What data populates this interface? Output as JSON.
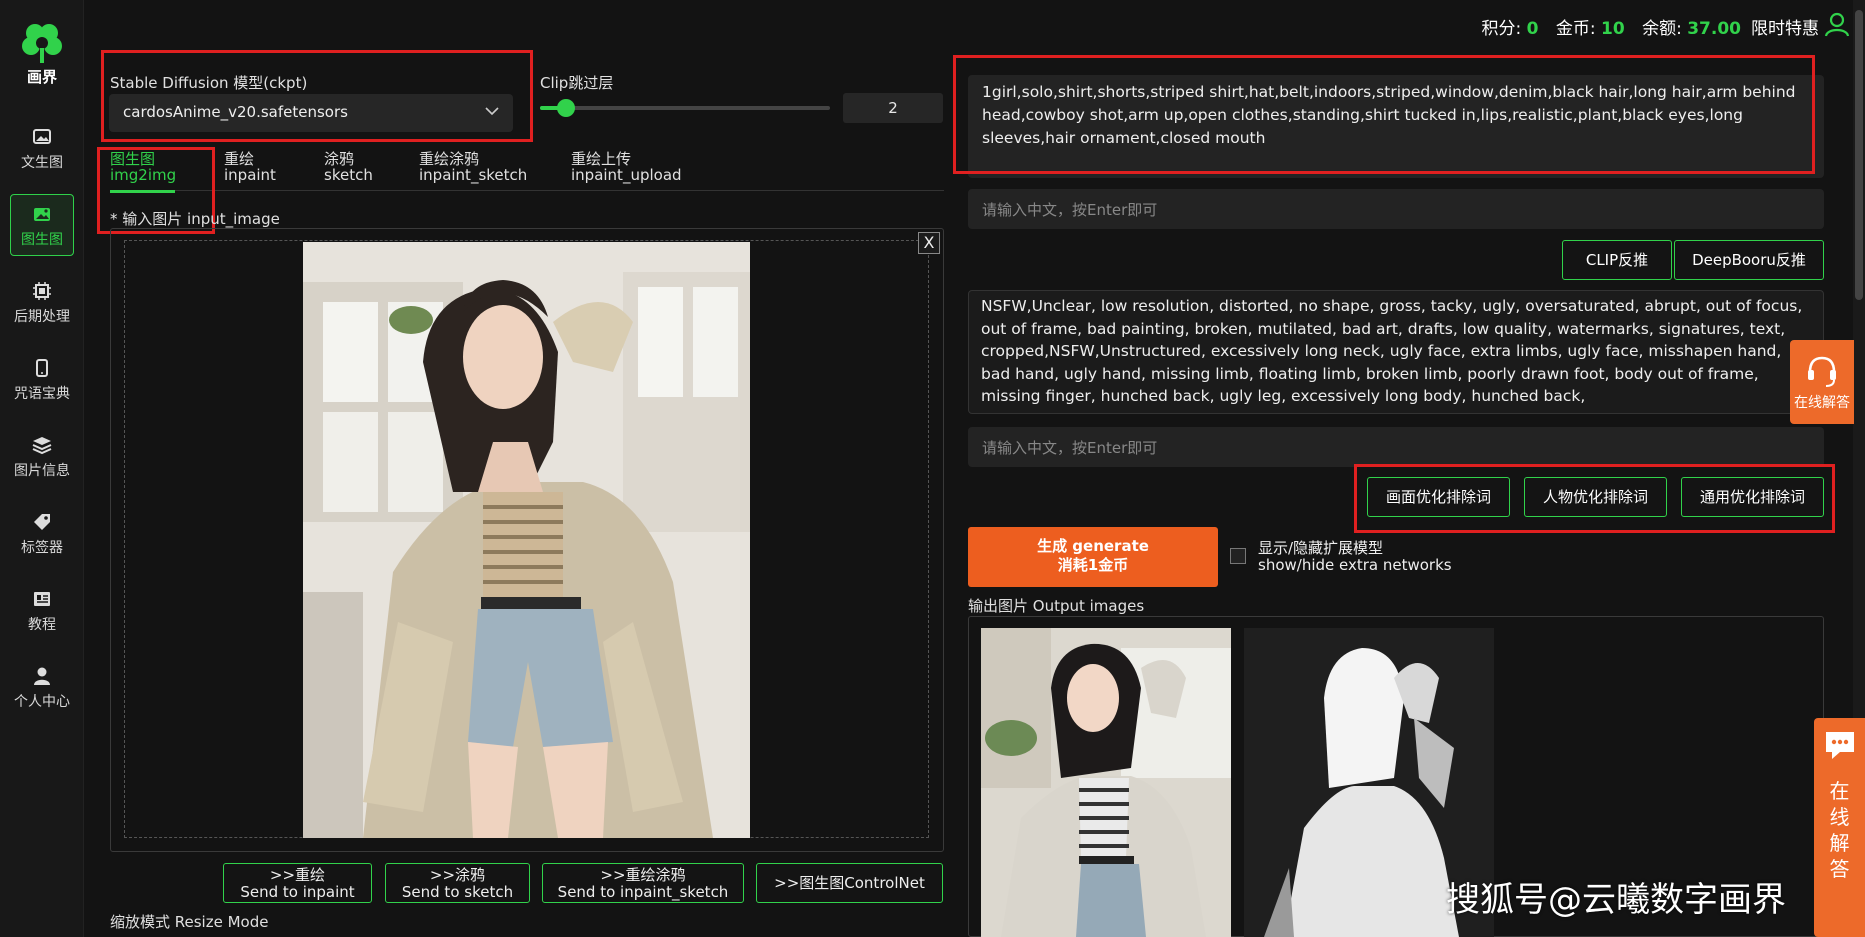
{
  "brand": {
    "name": "画界"
  },
  "sidebar": {
    "items": [
      {
        "label": "文生图",
        "icon": "image-icon"
      },
      {
        "label": "图生图",
        "icon": "image-to-image-icon",
        "active": true
      },
      {
        "label": "后期处理",
        "icon": "chip-icon"
      },
      {
        "label": "咒语宝典",
        "icon": "phone-book-icon"
      },
      {
        "label": "图片信息",
        "icon": "layers-icon"
      },
      {
        "label": "标签器",
        "icon": "tag-icon"
      },
      {
        "label": "教程",
        "icon": "book-icon"
      },
      {
        "label": "个人中心",
        "icon": "user-icon"
      }
    ]
  },
  "topbar": {
    "points_label": "积分:",
    "points_value": "0",
    "coins_label": "金币:",
    "coins_value": "10",
    "balance_label": "余额:",
    "balance_value": "37.00",
    "promo": "限时特惠"
  },
  "model": {
    "label": "Stable Diffusion 模型(ckpt)",
    "value": "cardosAnime_v20.safetensors"
  },
  "clip": {
    "label": "Clip跳过层",
    "value": "2",
    "slider_fraction": 0.09
  },
  "tabs": [
    {
      "line1": "图生图",
      "line2": "img2img",
      "active": true
    },
    {
      "line1": "重绘",
      "line2": "inpaint"
    },
    {
      "line1": "涂鸦",
      "line2": "sketch"
    },
    {
      "line1": "重绘涂鸦",
      "line2": "inpaint_sketch"
    },
    {
      "line1": "重绘上传",
      "line2": "inpaint_upload"
    }
  ],
  "input_image": {
    "label": "* 输入图片 input_image",
    "close": "X"
  },
  "send_buttons": [
    {
      "line1": ">>重绘",
      "line2": "Send to inpaint"
    },
    {
      "line1": ">>涂鸦",
      "line2": "Send to sketch"
    },
    {
      "line1": ">>重绘涂鸦",
      "line2": "Send to inpaint_sketch"
    },
    {
      "line1": ">>图生图ControlNet",
      "line2": ""
    }
  ],
  "resize_mode_label": "缩放模式 Resize Mode",
  "prompt": {
    "text": "1girl,solo,shirt,shorts,striped shirt,hat,belt,indoors,striped,window,denim,black hair,long hair,arm behind head,cowboy shot,arm up,open clothes,standing,shirt tucked in,lips,realistic,plant,black eyes,long sleeves,hair ornament,closed mouth",
    "cn_placeholder": "请输入中文，按Enter即可"
  },
  "interrogate": {
    "clip": "CLIP反推",
    "deepbooru": "DeepBooru反推"
  },
  "negative": {
    "text": "NSFW,Unclear, low resolution, distorted, no shape, gross, tacky, ugly, oversaturated, abrupt, out of focus, out of frame, bad painting, broken, mutilated, bad art, drafts, low quality, watermarks, signatures, text, cropped,NSFW,Unstructured, excessively long neck, ugly face, extra limbs, ugly face, misshapen hand, bad hand, ugly hand, missing limb, floating limb, broken limb, poorly drawn foot, body out of frame, missing finger, hunched back, ugly leg, excessively long body, hunched back,",
    "cn_placeholder": "请输入中文，按Enter即可"
  },
  "negative_presets": [
    {
      "label": "画面优化排除词"
    },
    {
      "label": "人物优化排除词"
    },
    {
      "label": "通用优化排除词"
    }
  ],
  "generate": {
    "line1": "生成 generate",
    "line2": "消耗1金币"
  },
  "extra_networks": {
    "line1": "显示/隐藏扩展模型",
    "line2": "show/hide extra networks"
  },
  "output": {
    "label": "输出图片 Output images"
  },
  "support": {
    "label": "在线解答",
    "vertical": [
      "在",
      "线",
      "解",
      "答"
    ]
  },
  "watermark": "搜狐号@云曦数字画界",
  "colors": {
    "accent": "#31d24b",
    "orange": "#ed5e1f",
    "highlight": "#e02020",
    "background": "#131313"
  }
}
